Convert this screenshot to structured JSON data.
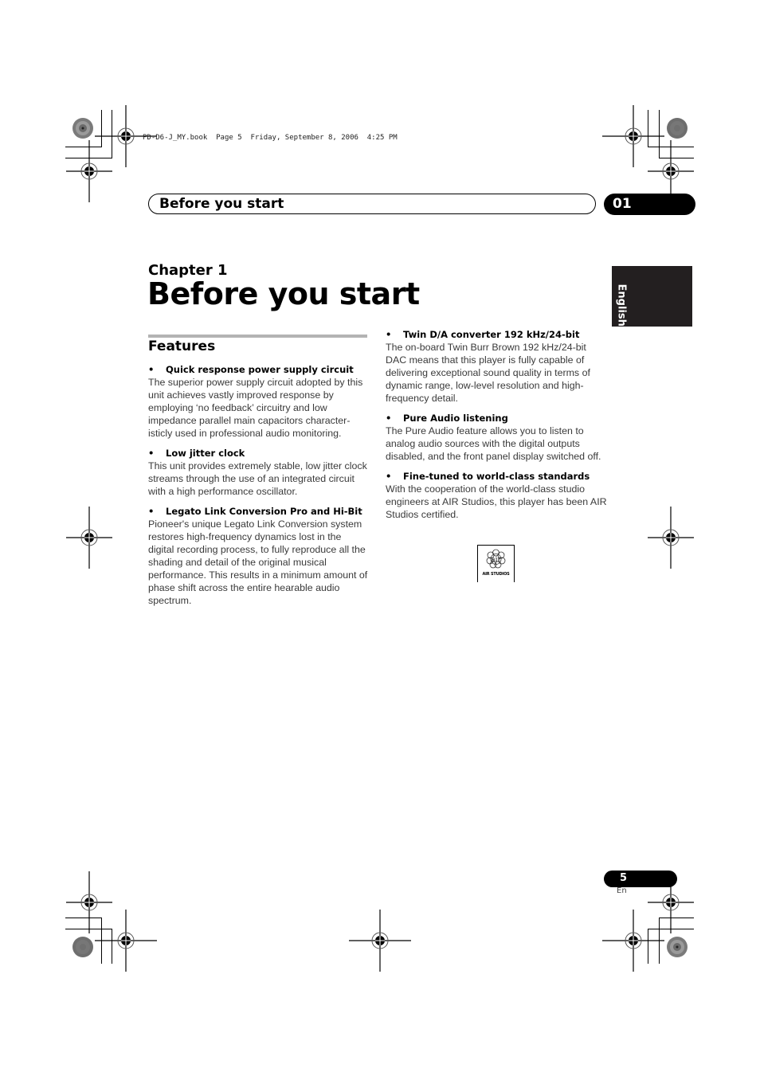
{
  "print_header": "PD-D6-J_MY.book  Page 5  Friday, September 8, 2006  4:25 PM",
  "running_header": {
    "section_title": "Before you start",
    "chapter_number": "01"
  },
  "language_tab": "English",
  "chapter": {
    "label": "Chapter 1",
    "title": "Before you start"
  },
  "features": {
    "heading": "Features",
    "bullet": "•",
    "left_column": [
      {
        "title": "Quick response power supply circuit",
        "body": "The superior power supply circuit adopted by this unit achieves vastly improved response by employing ‘no feedback’ circuitry and low impedance parallel main capacitors character-isticly used in professional audio monitoring."
      },
      {
        "title": "Low jitter clock",
        "body": "This unit provides extremely stable, low jitter clock streams through the use of an integrated circuit with a high performance oscillator."
      },
      {
        "title": "Legato Link Conversion Pro and Hi-Bit",
        "body": "Pioneer's unique Legato Link Conversion system restores high-frequency dynamics lost in the digital recording process, to fully reproduce all the shading and detail of the original musical performance. This results in a minimum amount of phase shift across the entire hearable audio spectrum."
      }
    ],
    "right_column": [
      {
        "title": "Twin D/A converter 192 kHz/24-bit",
        "body": "The on-board Twin Burr Brown 192 kHz/24-bit DAC means that this player is fully capable of delivering exceptional sound quality in terms of dynamic range, low-level resolution and high-frequency detail."
      },
      {
        "title": "Pure Audio listening",
        "body": "The Pure Audio feature allows you to listen to analog audio sources with the digital outputs disabled, and the front panel display switched off."
      },
      {
        "title": "Fine-tuned to world-class standards",
        "body": "With the cooperation of the world-class studio engineers at AIR Studios, this player has been AIR Studios certified."
      }
    ]
  },
  "air_logo": {
    "mark": "air",
    "caption": "AIR STUDIOS"
  },
  "footer": {
    "page_number": "5",
    "language_code": "En"
  }
}
